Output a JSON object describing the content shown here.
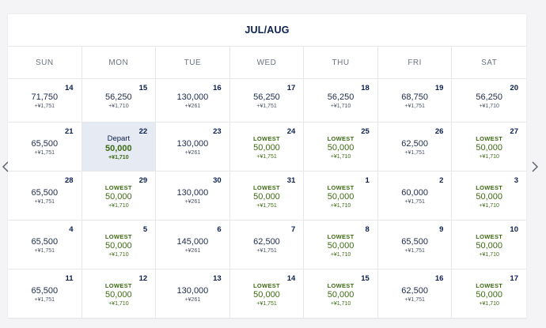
{
  "calendar": {
    "title": "JUL/AUG",
    "nav": {
      "prev_icon": "chevron-left-icon",
      "next_icon": "chevron-right-icon"
    },
    "weekdays": [
      "SUN",
      "MON",
      "TUE",
      "WED",
      "THU",
      "FRI",
      "SAT"
    ],
    "colors": {
      "lowest": "#3d6b12",
      "selected_bg": "#e5eaf3",
      "text": "#0b1f4f"
    },
    "days": [
      {
        "day": "14",
        "tag": "",
        "miles": "71,750",
        "tax": "+¥1,751",
        "lowest": false,
        "selected": false
      },
      {
        "day": "15",
        "tag": "",
        "miles": "56,250",
        "tax": "+¥1,710",
        "lowest": false,
        "selected": false
      },
      {
        "day": "16",
        "tag": "",
        "miles": "130,000",
        "tax": "+¥261",
        "lowest": false,
        "selected": false
      },
      {
        "day": "17",
        "tag": "",
        "miles": "56,250",
        "tax": "+¥1,751",
        "lowest": false,
        "selected": false
      },
      {
        "day": "18",
        "tag": "",
        "miles": "56,250",
        "tax": "+¥1,710",
        "lowest": false,
        "selected": false
      },
      {
        "day": "19",
        "tag": "",
        "miles": "68,750",
        "tax": "+¥1,751",
        "lowest": false,
        "selected": false
      },
      {
        "day": "20",
        "tag": "",
        "miles": "56,250",
        "tax": "+¥1,710",
        "lowest": false,
        "selected": false
      },
      {
        "day": "21",
        "tag": "",
        "miles": "65,500",
        "tax": "+¥1,751",
        "lowest": false,
        "selected": false
      },
      {
        "day": "22",
        "tag": "Depart",
        "miles": "50,000",
        "tax": "+¥1,710",
        "lowest": false,
        "selected": true
      },
      {
        "day": "23",
        "tag": "",
        "miles": "130,000",
        "tax": "+¥261",
        "lowest": false,
        "selected": false
      },
      {
        "day": "24",
        "tag": "LOWEST",
        "miles": "50,000",
        "tax": "+¥1,751",
        "lowest": true,
        "selected": false
      },
      {
        "day": "25",
        "tag": "LOWEST",
        "miles": "50,000",
        "tax": "+¥1,710",
        "lowest": true,
        "selected": false
      },
      {
        "day": "26",
        "tag": "",
        "miles": "62,500",
        "tax": "+¥1,751",
        "lowest": false,
        "selected": false
      },
      {
        "day": "27",
        "tag": "LOWEST",
        "miles": "50,000",
        "tax": "+¥1,710",
        "lowest": true,
        "selected": false
      },
      {
        "day": "28",
        "tag": "",
        "miles": "65,500",
        "tax": "+¥1,751",
        "lowest": false,
        "selected": false
      },
      {
        "day": "29",
        "tag": "LOWEST",
        "miles": "50,000",
        "tax": "+¥1,710",
        "lowest": true,
        "selected": false
      },
      {
        "day": "30",
        "tag": "",
        "miles": "130,000",
        "tax": "+¥261",
        "lowest": false,
        "selected": false
      },
      {
        "day": "31",
        "tag": "LOWEST",
        "miles": "50,000",
        "tax": "+¥1,751",
        "lowest": true,
        "selected": false
      },
      {
        "day": "1",
        "tag": "LOWEST",
        "miles": "50,000",
        "tax": "+¥1,710",
        "lowest": true,
        "selected": false
      },
      {
        "day": "2",
        "tag": "",
        "miles": "60,000",
        "tax": "+¥1,751",
        "lowest": false,
        "selected": false
      },
      {
        "day": "3",
        "tag": "LOWEST",
        "miles": "50,000",
        "tax": "+¥1,710",
        "lowest": true,
        "selected": false
      },
      {
        "day": "4",
        "tag": "",
        "miles": "65,500",
        "tax": "+¥1,751",
        "lowest": false,
        "selected": false
      },
      {
        "day": "5",
        "tag": "LOWEST",
        "miles": "50,000",
        "tax": "+¥1,710",
        "lowest": true,
        "selected": false
      },
      {
        "day": "6",
        "tag": "",
        "miles": "145,000",
        "tax": "+¥261",
        "lowest": false,
        "selected": false
      },
      {
        "day": "7",
        "tag": "",
        "miles": "62,500",
        "tax": "+¥1,751",
        "lowest": false,
        "selected": false
      },
      {
        "day": "8",
        "tag": "LOWEST",
        "miles": "50,000",
        "tax": "+¥1,710",
        "lowest": true,
        "selected": false
      },
      {
        "day": "9",
        "tag": "",
        "miles": "65,500",
        "tax": "+¥1,751",
        "lowest": false,
        "selected": false
      },
      {
        "day": "10",
        "tag": "LOWEST",
        "miles": "50,000",
        "tax": "+¥1,710",
        "lowest": true,
        "selected": false
      },
      {
        "day": "11",
        "tag": "",
        "miles": "65,500",
        "tax": "+¥1,751",
        "lowest": false,
        "selected": false
      },
      {
        "day": "12",
        "tag": "LOWEST",
        "miles": "50,000",
        "tax": "+¥1,710",
        "lowest": true,
        "selected": false
      },
      {
        "day": "13",
        "tag": "",
        "miles": "130,000",
        "tax": "+¥261",
        "lowest": false,
        "selected": false
      },
      {
        "day": "14",
        "tag": "LOWEST",
        "miles": "50,000",
        "tax": "+¥1,751",
        "lowest": true,
        "selected": false
      },
      {
        "day": "15",
        "tag": "LOWEST",
        "miles": "50,000",
        "tax": "+¥1,710",
        "lowest": true,
        "selected": false
      },
      {
        "day": "16",
        "tag": "",
        "miles": "62,500",
        "tax": "+¥1,751",
        "lowest": false,
        "selected": false
      },
      {
        "day": "17",
        "tag": "LOWEST",
        "miles": "50,000",
        "tax": "+¥1,710",
        "lowest": true,
        "selected": false
      }
    ]
  }
}
